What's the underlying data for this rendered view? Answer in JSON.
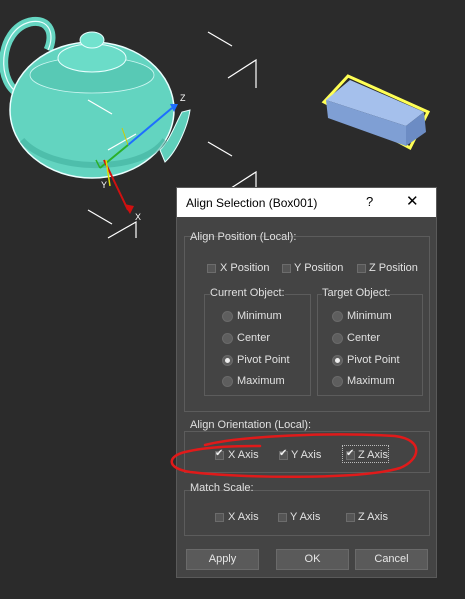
{
  "viewport": {
    "gizmo_axis_x": "X",
    "gizmo_axis_y": "Y",
    "gizmo_axis_z": "Z",
    "colors": {
      "teapot": "#66d6c2",
      "box": "#9db8e6",
      "selection": "#ffff55",
      "background": "#2b2b2b"
    }
  },
  "dialog": {
    "title": "Align Selection (Box001)",
    "help_label": "?",
    "close_label": "✕",
    "align_position": {
      "label": "Align Position (Local):",
      "x_label": "X Position",
      "x_checked": false,
      "y_label": "Y Position",
      "y_checked": false,
      "z_label": "Z Position",
      "z_checked": false,
      "current": {
        "label": "Current Object:",
        "options": [
          "Minimum",
          "Center",
          "Pivot Point",
          "Maximum"
        ],
        "selected": "Pivot Point"
      },
      "target": {
        "label": "Target Object:",
        "options": [
          "Minimum",
          "Center",
          "Pivot Point",
          "Maximum"
        ],
        "selected": "Pivot Point"
      }
    },
    "align_orientation": {
      "label": "Align Orientation (Local):",
      "x_label": "X Axis",
      "x_checked": true,
      "y_label": "Y Axis",
      "y_checked": true,
      "z_label": "Z Axis",
      "z_checked": true
    },
    "match_scale": {
      "label": "Match Scale:",
      "x_label": "X Axis",
      "x_checked": false,
      "y_label": "Y Axis",
      "y_checked": false,
      "z_label": "Z Axis",
      "z_checked": false
    },
    "buttons": {
      "apply": "Apply",
      "ok": "OK",
      "cancel": "Cancel"
    }
  },
  "annotation": {
    "color": "#e01a1a"
  }
}
